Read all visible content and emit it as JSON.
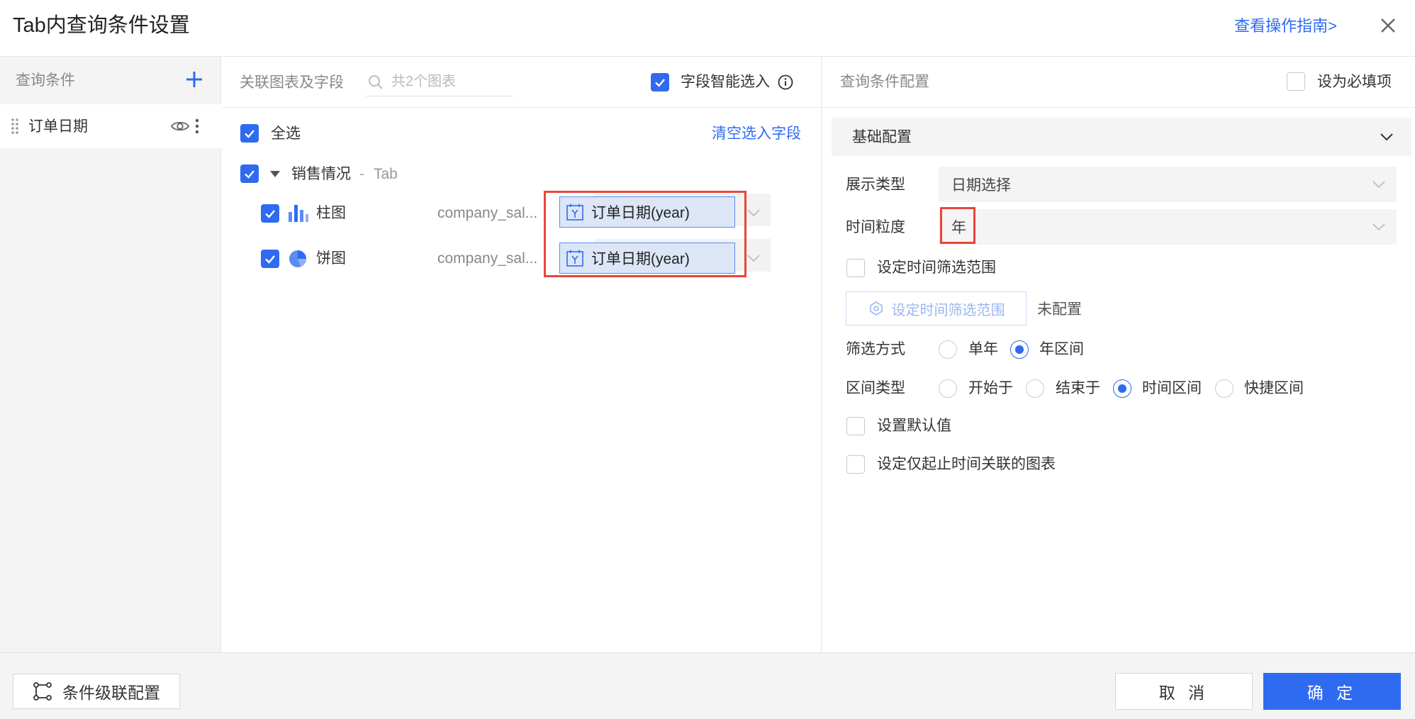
{
  "dialog": {
    "title": "Tab内查询条件设置",
    "guide_link": "查看操作指南>"
  },
  "left": {
    "title": "查询条件",
    "conditions": [
      {
        "label": "订单日期"
      }
    ]
  },
  "middle": {
    "title": "关联图表及字段",
    "search_placeholder": "共2个图表",
    "smart_select_label": "字段智能选入",
    "select_all_label": "全选",
    "clear_link": "清空选入字段",
    "group": {
      "name": "销售情况",
      "separator": "-",
      "type": "Tab"
    },
    "charts": [
      {
        "name": "柱图",
        "dataset": "company_sal...",
        "field": "订单日期(year)",
        "checked": true
      },
      {
        "name": "饼图",
        "dataset": "company_sal...",
        "field": "订单日期(year)",
        "checked": true
      }
    ]
  },
  "right": {
    "title": "查询条件配置",
    "required_label": "设为必填项",
    "section_title": "基础配置",
    "display_type_label": "展示类型",
    "display_type_value": "日期选择",
    "granularity_label": "时间粒度",
    "granularity_value": "年",
    "set_range_label": "设定时间筛选范围",
    "set_range_button": "设定时间筛选范围",
    "range_status": "未配置",
    "filter_mode_label": "筛选方式",
    "filter_modes": [
      "单年",
      "年区间"
    ],
    "filter_mode_selected": "年区间",
    "range_type_label": "区间类型",
    "range_types": [
      "开始于",
      "结束于",
      "时间区间",
      "快捷区间"
    ],
    "range_type_selected": "时间区间",
    "default_value_label": "设置默认值",
    "start_end_label": "设定仅起止时间关联的图表"
  },
  "footer": {
    "cascade_button": "条件级联配置",
    "cancel_button": "取 消",
    "ok_button": "确 定"
  },
  "colors": {
    "accent": "#2f6bf0",
    "highlight": "#e8463a"
  }
}
